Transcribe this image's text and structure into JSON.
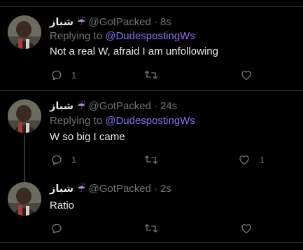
{
  "colors": {
    "background": "#000000",
    "text_primary": "#e7e9ea",
    "text_secondary": "#71767b",
    "mention": "#8e6ef6",
    "divider": "#2f3336"
  },
  "tweets": [
    {
      "display_name": "شباز",
      "badge_icon": "umbrella-rain-icon",
      "badge_glyph": "☔",
      "handle": "@GotPacked",
      "separator": "·",
      "time": "8s",
      "replying_prefix": "Replying to",
      "replying_to": "@DudespostingWs",
      "text": "Not a real W, afraid I am unfollowing",
      "reply_count": "1",
      "retweet_count": "",
      "like_count": ""
    },
    {
      "display_name": "شباز",
      "badge_icon": "umbrella-rain-icon",
      "badge_glyph": "☔",
      "handle": "@GotPacked",
      "separator": "·",
      "time": "24s",
      "replying_prefix": "Replying to",
      "replying_to": "@DudespostingWs",
      "text": "W so big I came",
      "reply_count": "1",
      "retweet_count": "",
      "like_count": "1"
    },
    {
      "display_name": "شباز",
      "badge_icon": "umbrella-rain-icon",
      "badge_glyph": "☔",
      "handle": "@GotPacked",
      "separator": "·",
      "time": "2s",
      "replying_prefix": "",
      "replying_to": "",
      "text": "Ratio",
      "reply_count": "",
      "retweet_count": "",
      "like_count": ""
    }
  ]
}
